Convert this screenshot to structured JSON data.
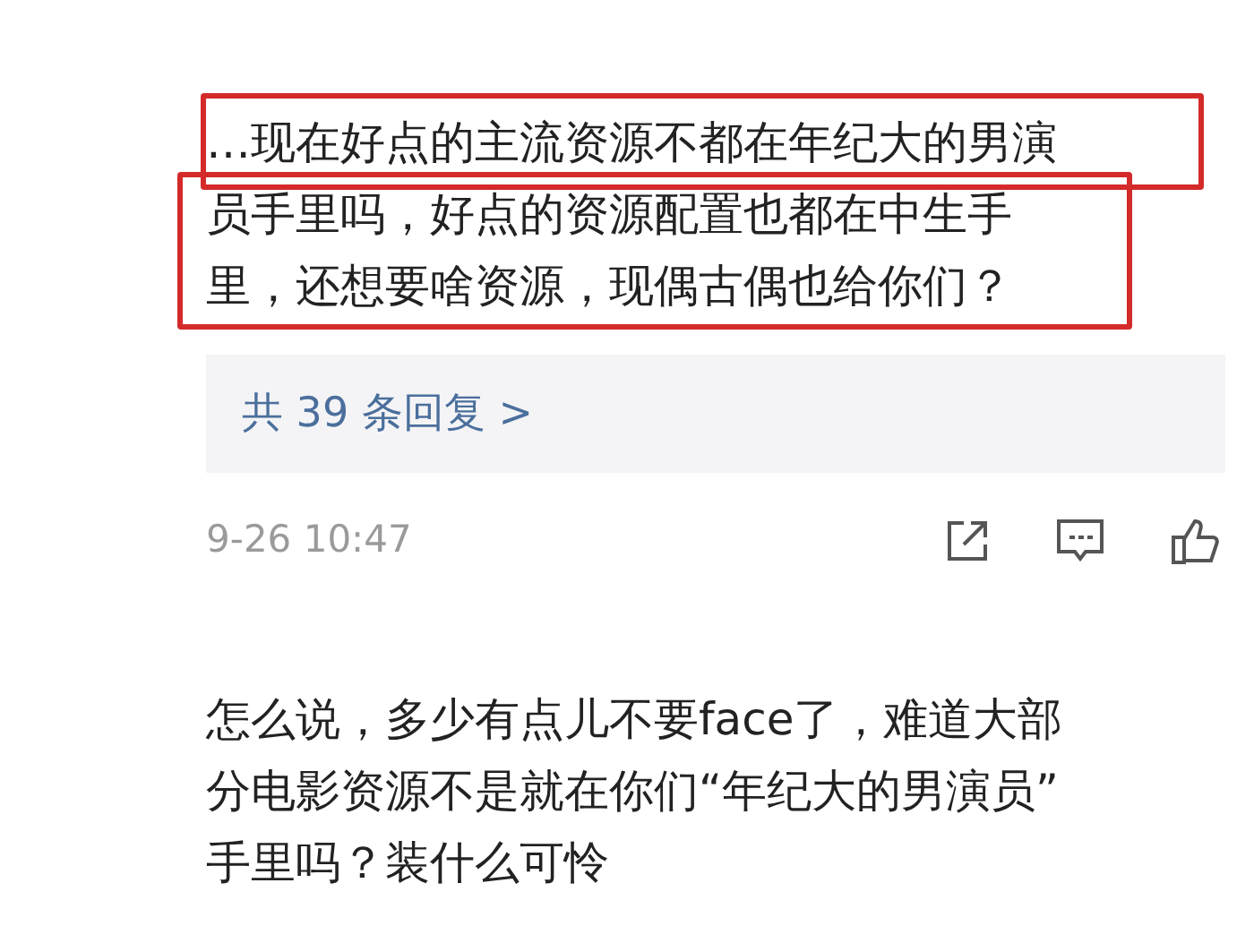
{
  "comments": [
    {
      "lines": [
        "…现在好点的主流资源不都在年纪大的男演",
        "员手里吗，好点的资源配置也都在中生手",
        "里，还想要啥资源，现偶古偶也给你们？"
      ],
      "highlighted": true,
      "replies": "共 39 条回复 >",
      "time": "9-26 10:47"
    },
    {
      "lines": [
        "怎么说，多少有点儿不要face了，难道大部",
        "分电影资源不是就在你们“年纪大的男演员”",
        "手里吗？装什么可怜"
      ]
    }
  ]
}
